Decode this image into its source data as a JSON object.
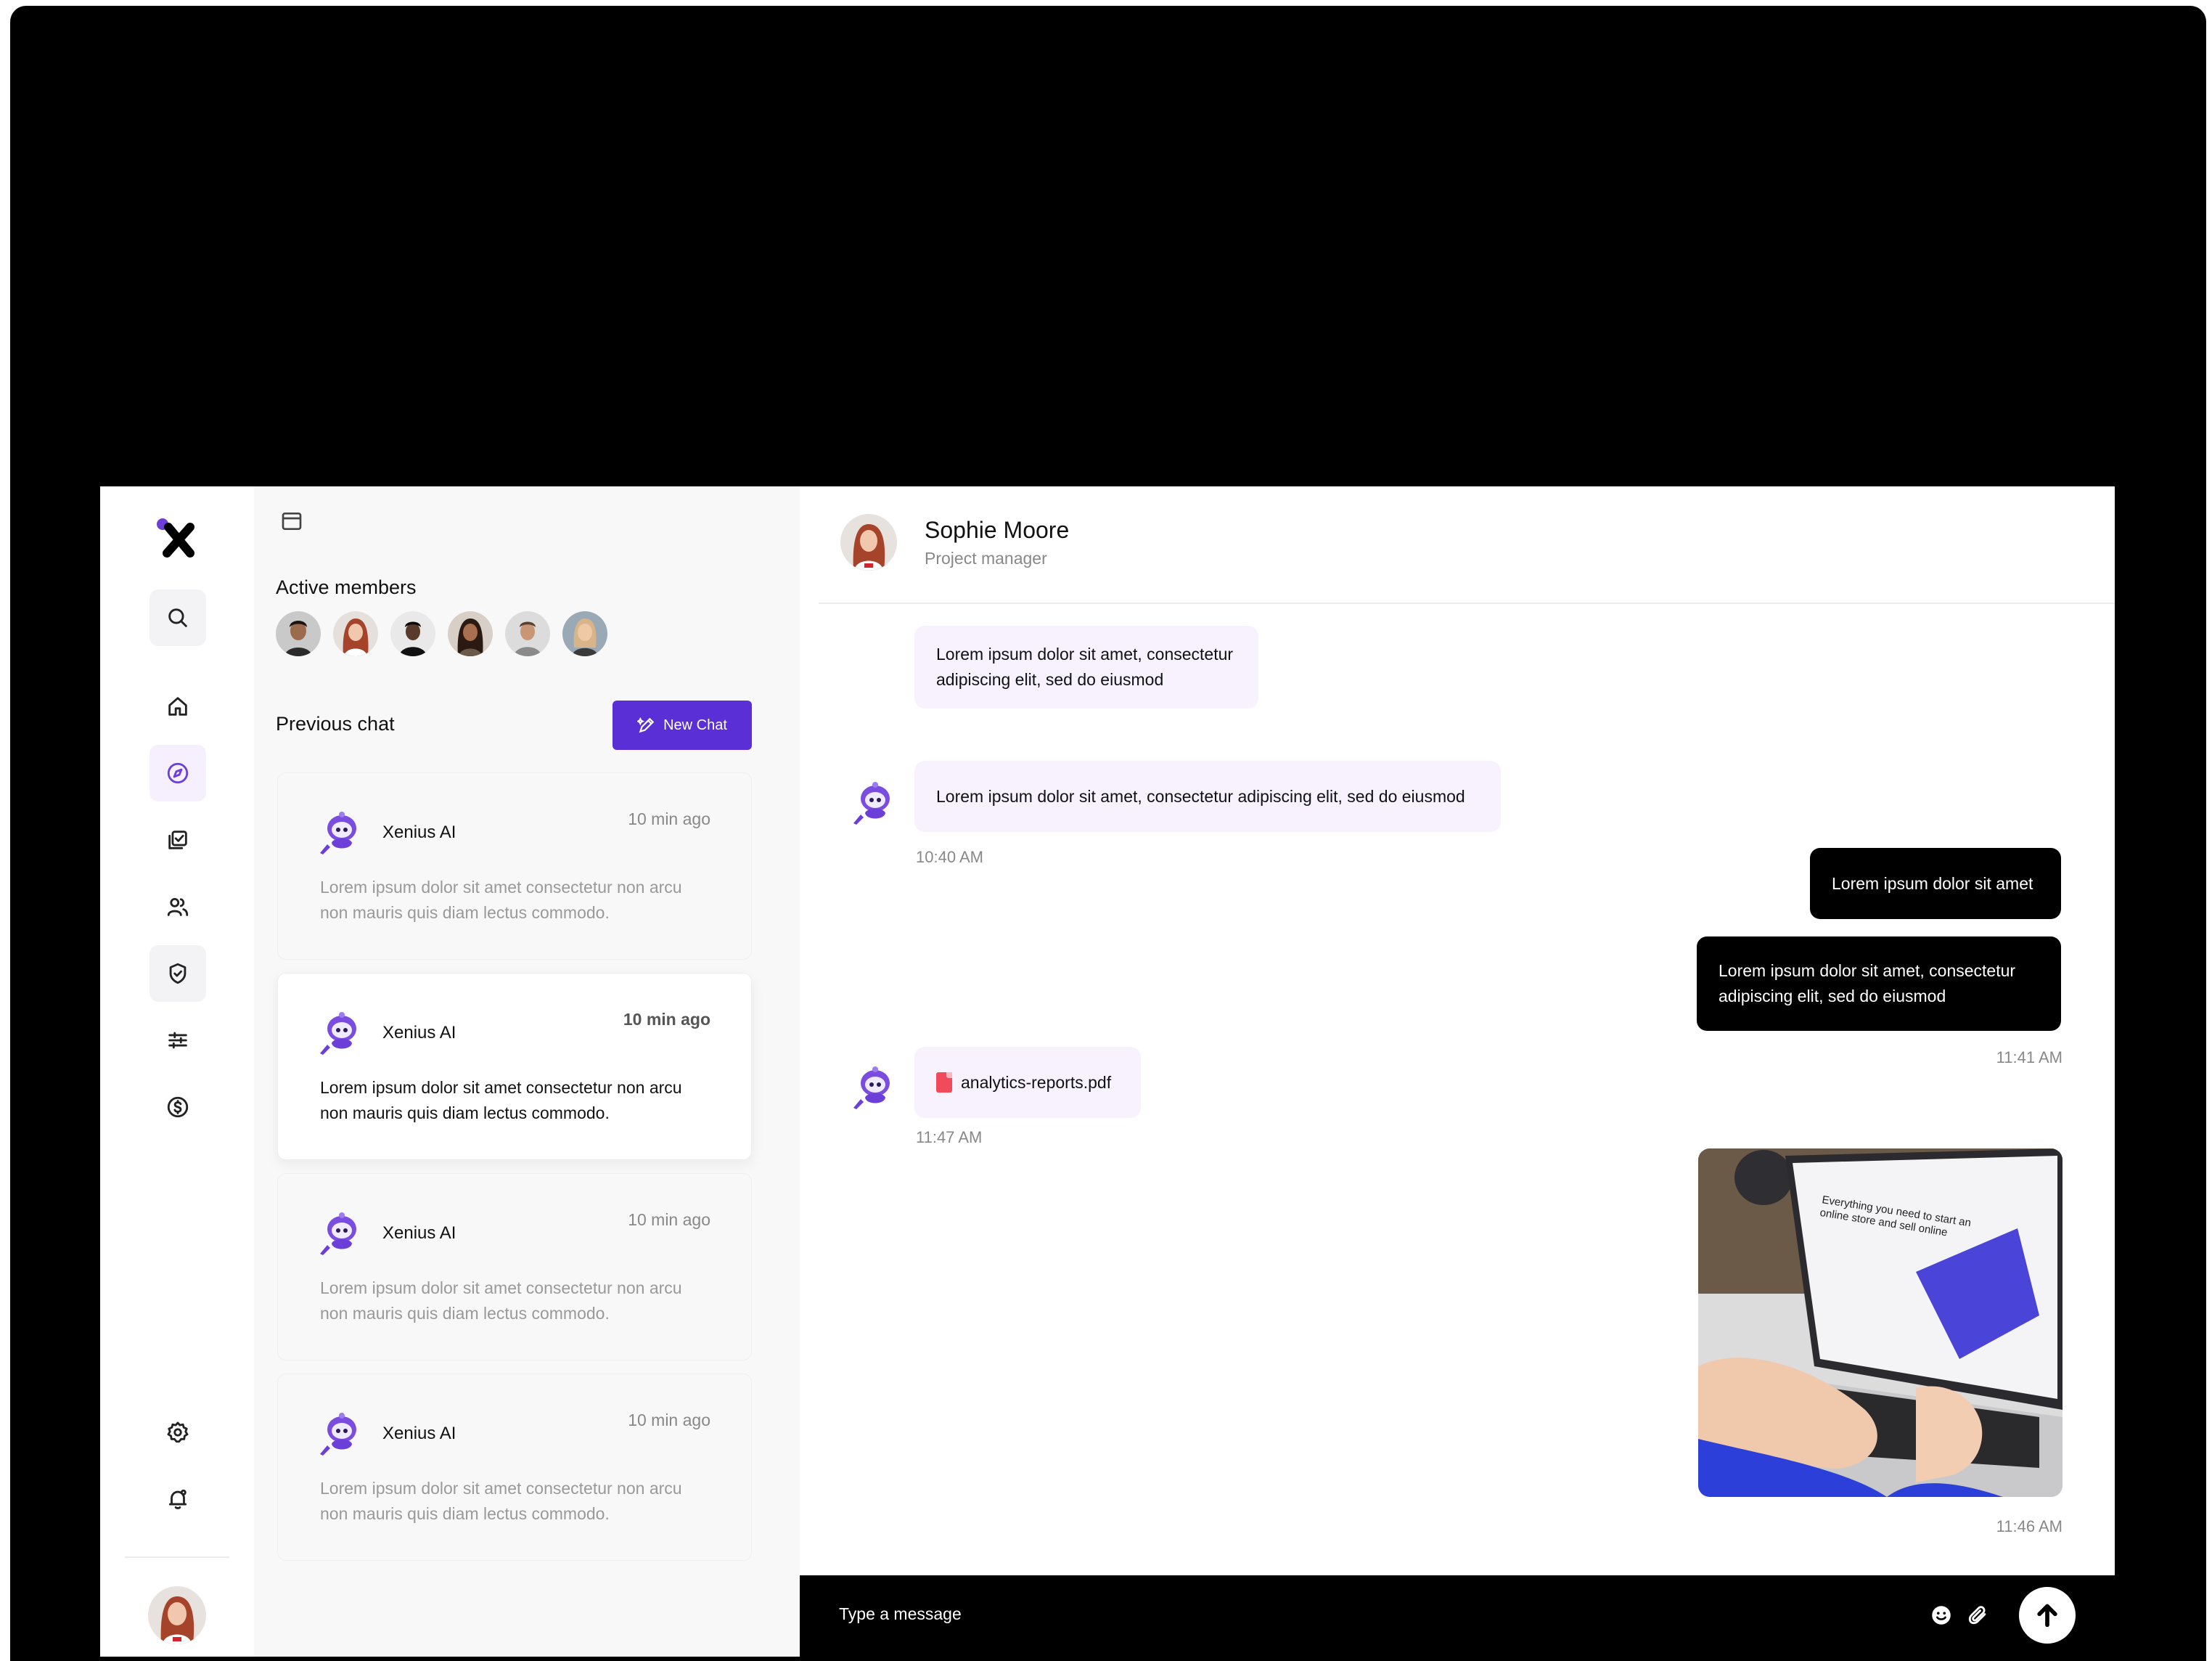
{
  "app": {
    "brand_color": "#5b2fd6"
  },
  "rail": {
    "items": [
      "search-icon",
      "home-icon",
      "compass-icon",
      "checklist-icon",
      "users-icon",
      "shield-check-icon",
      "sliders-icon",
      "dollar-icon"
    ],
    "bottom_items": [
      "gear-icon",
      "bell-icon"
    ]
  },
  "panel": {
    "active_members_title": "Active members",
    "previous_chat_title": "Previous chat",
    "new_chat_label": "New Chat",
    "chats": [
      {
        "name": "Xenius AI",
        "time": "10 min ago",
        "preview": "Lorem ipsum dolor sit amet consectetur non arcu non mauris quis diam lectus commodo."
      },
      {
        "name": "Xenius AI",
        "time": "10 min ago",
        "preview": "Lorem ipsum dolor sit amet consectetur non arcu non mauris quis diam lectus commodo."
      },
      {
        "name": "Xenius AI",
        "time": "10 min ago",
        "preview": "Lorem ipsum dolor sit amet consectetur non arcu non mauris quis diam lectus commodo."
      },
      {
        "name": "Xenius AI",
        "time": "10 min ago",
        "preview": "Lorem ipsum dolor sit amet consectetur non arcu non mauris quis diam lectus commodo."
      }
    ]
  },
  "conversation": {
    "contact_name": "Sophie Moore",
    "contact_role": "Project manager",
    "messages": [
      {
        "text": "Lorem ipsum dolor sit amet, consectetur adipiscing elit, sed do eiusmod"
      },
      {
        "text": "Lorem ipsum dolor sit amet, consectetur adipiscing elit, sed do eiusmod"
      },
      {
        "time": "10:40 AM"
      },
      {
        "text": "Lorem ipsum dolor sit amet"
      },
      {
        "text": "Lorem ipsum dolor sit amet, consectetur adipiscing elit, sed do eiusmod"
      },
      {
        "time": "11:41 AM"
      },
      {
        "file": "analytics-reports.pdf"
      },
      {
        "time": "11:47 AM"
      },
      {
        "time": "11:46 AM"
      }
    ],
    "photo_text": "Everything you need to start an online store and sell online"
  },
  "composer": {
    "placeholder": "Type a message"
  }
}
